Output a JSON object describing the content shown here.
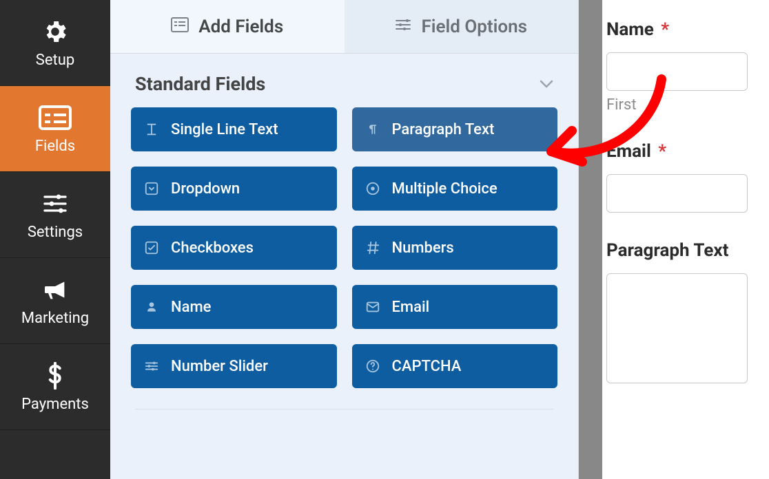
{
  "sidebar": {
    "items": [
      {
        "label": "Setup"
      },
      {
        "label": "Fields"
      },
      {
        "label": "Settings"
      },
      {
        "label": "Marketing"
      },
      {
        "label": "Payments"
      }
    ],
    "active_index": 1
  },
  "tabs": {
    "add_fields": "Add Fields",
    "field_options": "Field Options",
    "active": "add_fields"
  },
  "section": {
    "title": "Standard Fields"
  },
  "fields": {
    "single_line_text": "Single Line Text",
    "paragraph_text": "Paragraph Text",
    "dropdown": "Dropdown",
    "multiple_choice": "Multiple Choice",
    "checkboxes": "Checkboxes",
    "numbers": "Numbers",
    "name": "Name",
    "email": "Email",
    "number_slider": "Number Slider",
    "captcha": "CAPTCHA"
  },
  "preview": {
    "name_label": "Name",
    "name_sub": "First",
    "email_label": "Email",
    "para_label": "Paragraph Text",
    "required_marker": "*"
  },
  "colors": {
    "sidebar_bg": "#2c2c2c",
    "sidebar_active": "#e27730",
    "field_btn": "#0d5da0",
    "field_btn_hover": "#31699f",
    "panel_bg": "#eaf1fb",
    "annotation": "#ff0000"
  }
}
